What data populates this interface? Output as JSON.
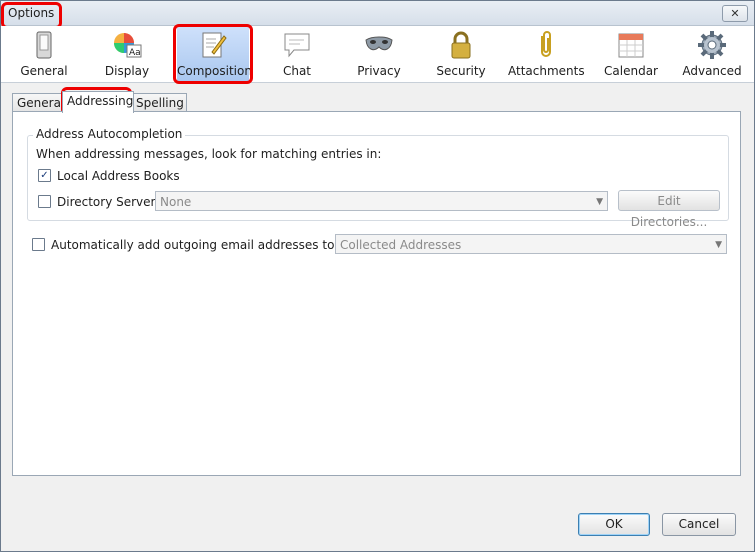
{
  "window": {
    "title": "Options",
    "close_glyph": "✕"
  },
  "toolbar": {
    "items": [
      {
        "label": "General",
        "icon": "phone-icon"
      },
      {
        "label": "Display",
        "icon": "color-wheel-icon"
      },
      {
        "label": "Composition",
        "icon": "pencil-document-icon",
        "selected": true
      },
      {
        "label": "Chat",
        "icon": "chat-bubble-icon"
      },
      {
        "label": "Privacy",
        "icon": "mask-icon"
      },
      {
        "label": "Security",
        "icon": "padlock-icon"
      },
      {
        "label": "Attachments",
        "icon": "paperclip-icon"
      },
      {
        "label": "Calendar",
        "icon": "calendar-icon"
      },
      {
        "label": "Advanced",
        "icon": "gear-icon"
      }
    ]
  },
  "tabs": [
    {
      "label": "General"
    },
    {
      "label": "Addressing",
      "active": true
    },
    {
      "label": "Spelling"
    }
  ],
  "autocompletion": {
    "group_label": "Address Autocompletion",
    "description": "When addressing messages, look for matching entries in:",
    "local_books": {
      "label": "Local Address Books",
      "checked": true
    },
    "directory_server": {
      "label": "Directory Server:",
      "checked": false,
      "value": "None"
    },
    "edit_directories_label": "Edit Directories..."
  },
  "auto_add": {
    "label": "Automatically add outgoing email addresses to my:",
    "checked": false,
    "value": "Collected Addresses"
  },
  "footer": {
    "ok_label": "OK",
    "cancel_label": "Cancel"
  },
  "colors": {
    "highlight": "#e00000",
    "selected_tab": "#a9c7ef"
  }
}
